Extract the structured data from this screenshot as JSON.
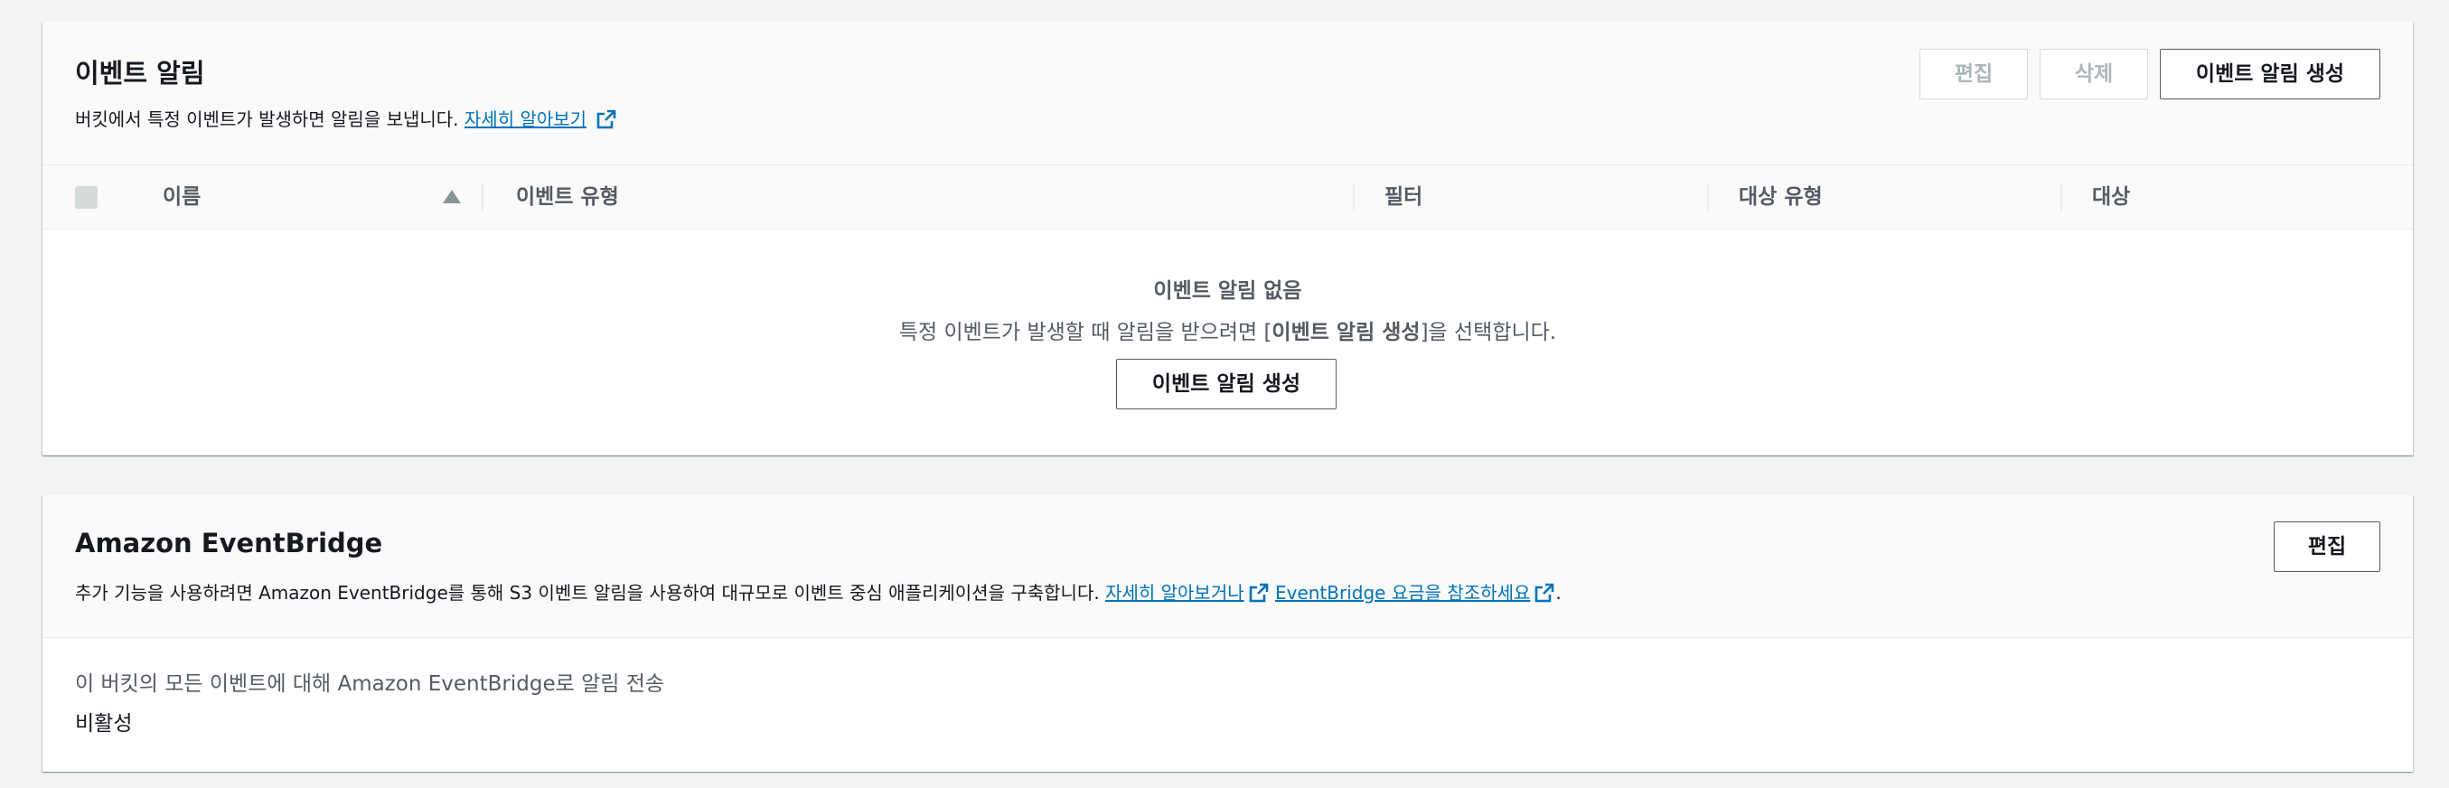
{
  "event_notifications": {
    "title": "이벤트 알림",
    "description": "버킷에서 특정 이벤트가 발생하면 알림을 보냅니다.",
    "learn_more_link": "자세히 알아보기",
    "buttons": {
      "edit": "편집",
      "delete": "삭제",
      "create": "이벤트 알림 생성"
    },
    "table": {
      "columns": [
        "이름",
        "이벤트 유형",
        "필터",
        "대상 유형",
        "대상"
      ],
      "sorted_column": "이름",
      "sort_direction": "ascending",
      "rows": []
    },
    "empty_state": {
      "title": "이벤트 알림 없음",
      "desc_prefix": "특정 이벤트가 발생할 때 알림을 받으려면 [",
      "desc_bold": "이벤트 알림 생성",
      "desc_suffix": "]을 선택합니다.",
      "button": "이벤트 알림 생성"
    }
  },
  "eventbridge": {
    "title": "Amazon EventBridge",
    "description": "추가 기능을 사용하려면 Amazon EventBridge를 통해 S3 이벤트 알림을 사용하여 대규모로 이벤트 중심 애플리케이션을 구축합니다.",
    "learn_more_link": "자세히 알아보거나",
    "pricing_link": "EventBridge 요금을 참조하세요",
    "trailing_period": ".",
    "edit_button": "편집",
    "setting_label": "이 버킷의 모든 이벤트에 대해 Amazon EventBridge로 알림 전송",
    "setting_value": "비활성"
  },
  "icons": {
    "external_link": "external-link-icon",
    "sort": "sort-ascending-icon"
  },
  "colors": {
    "link": "#0073bb",
    "primary_text": "#16191f",
    "secondary_text": "#545b64",
    "disabled": "#aab7b8",
    "background": "#f2f3f3"
  }
}
